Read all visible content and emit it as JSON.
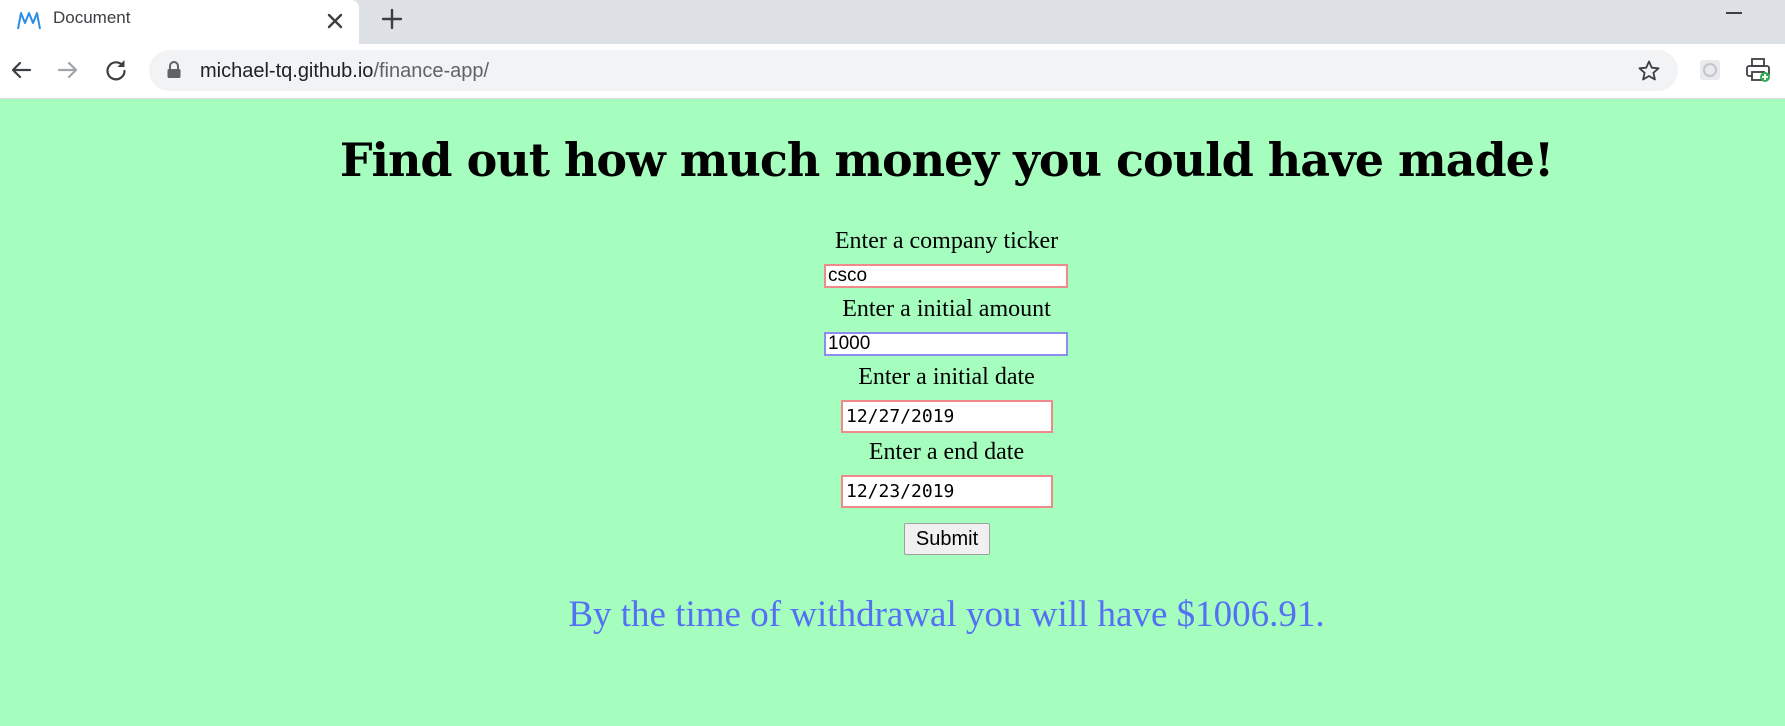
{
  "browser": {
    "tab_title": "Document",
    "url_host": "michael-tq.github.io",
    "url_path": "/finance-app/",
    "icons": {
      "favicon": "finance-app-favicon",
      "tab_close": "close-icon",
      "new_tab": "plus-icon",
      "back": "back-arrow-icon",
      "forward": "forward-arrow-icon",
      "reload": "reload-icon",
      "lock": "lock-icon",
      "bookmark": "star-icon",
      "extension_1": "extension-icon",
      "extension_2": "printer-extension-icon"
    }
  },
  "page": {
    "background": "#a5fdbe",
    "headline": "Find out how much money you could have made!",
    "form": {
      "ticker_label": "Enter a company ticker",
      "ticker_value": "csco",
      "amount_label": "Enter a initial amount",
      "amount_value": "1000",
      "initial_date_label": "Enter a initial date",
      "initial_date_value": "12/27/2019",
      "end_date_label": "Enter a end date",
      "end_date_value": "12/23/2019",
      "submit_label": "Submit"
    },
    "result_text": "By the time of withdrawal you will have $1006.91.",
    "result_color": "#5470f5"
  }
}
